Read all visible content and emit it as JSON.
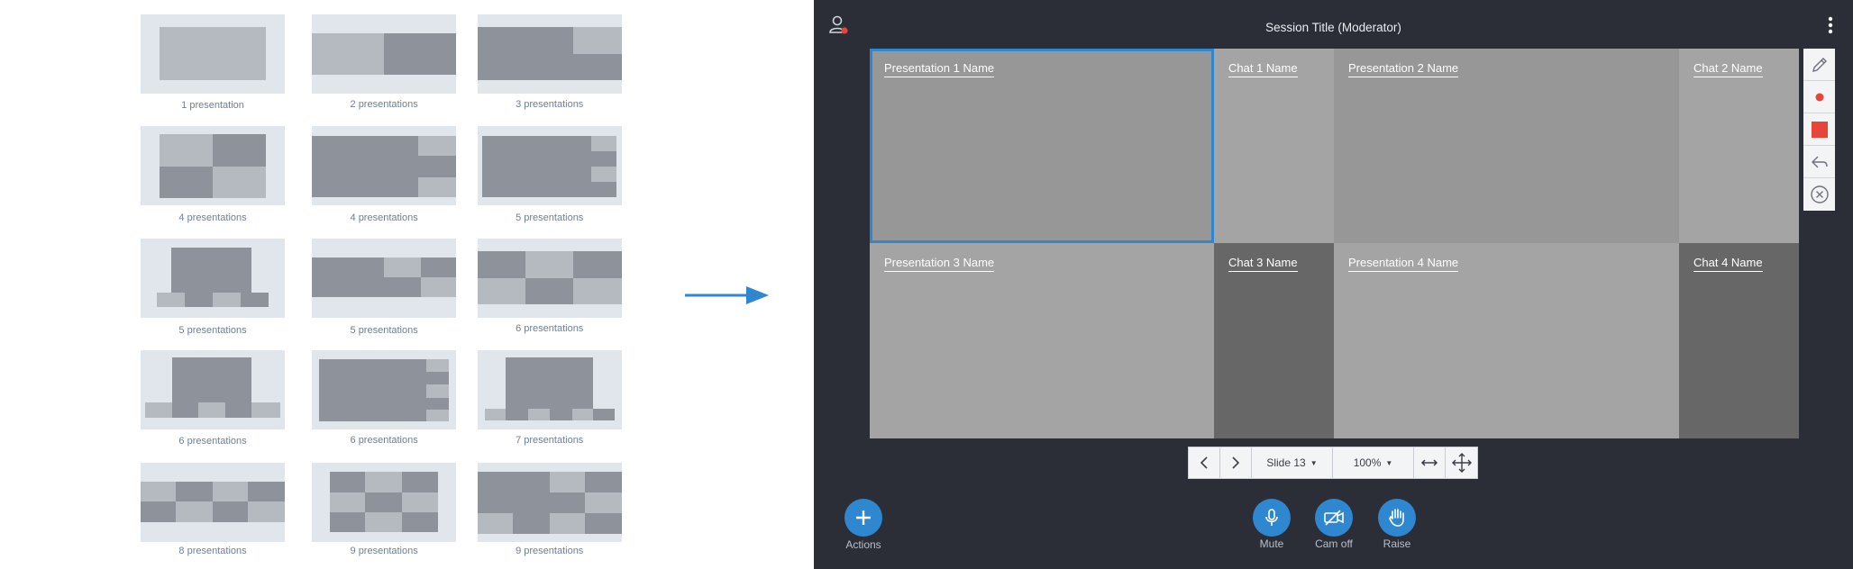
{
  "layouts": [
    {
      "caption": "1 presentation"
    },
    {
      "caption": "2 presentations"
    },
    {
      "caption": "3 presentations"
    },
    {
      "caption": "4 presentations"
    },
    {
      "caption": "4 presentations"
    },
    {
      "caption": "5 presentations"
    },
    {
      "caption": "5 presentations"
    },
    {
      "caption": "5 presentations"
    },
    {
      "caption": "6 presentations"
    },
    {
      "caption": "6 presentations"
    },
    {
      "caption": "6 presentations"
    },
    {
      "caption": "7 presentations"
    },
    {
      "caption": "8 presentations"
    },
    {
      "caption": "9 presentations"
    },
    {
      "caption": "9 presentations"
    }
  ],
  "session": {
    "title": "Session Title (Moderator)",
    "presentation_cells": [
      "Presentation 1 Name",
      "Presentation 2 Name",
      "Presentation 3 Name",
      "Presentation 4 Name"
    ],
    "chat_cells": [
      "Chat 1 Name",
      "Chat 2 Name",
      "Chat 3 Name",
      "Chat 4 Name"
    ],
    "toolbar_icons": [
      "pencil-icon",
      "red-dot-icon",
      "red-square-icon",
      "undo-icon",
      "close-circle-icon"
    ],
    "pager": {
      "slide": "Slide 13",
      "zoom": "100%"
    },
    "actions_label": "Actions",
    "buttons": {
      "mute": "Mute",
      "cam": "Cam off",
      "raise": "Raise"
    }
  },
  "colors": {
    "accent": "#2f87cf",
    "record_red": "#e8443a",
    "panel": "#2b2e36"
  }
}
